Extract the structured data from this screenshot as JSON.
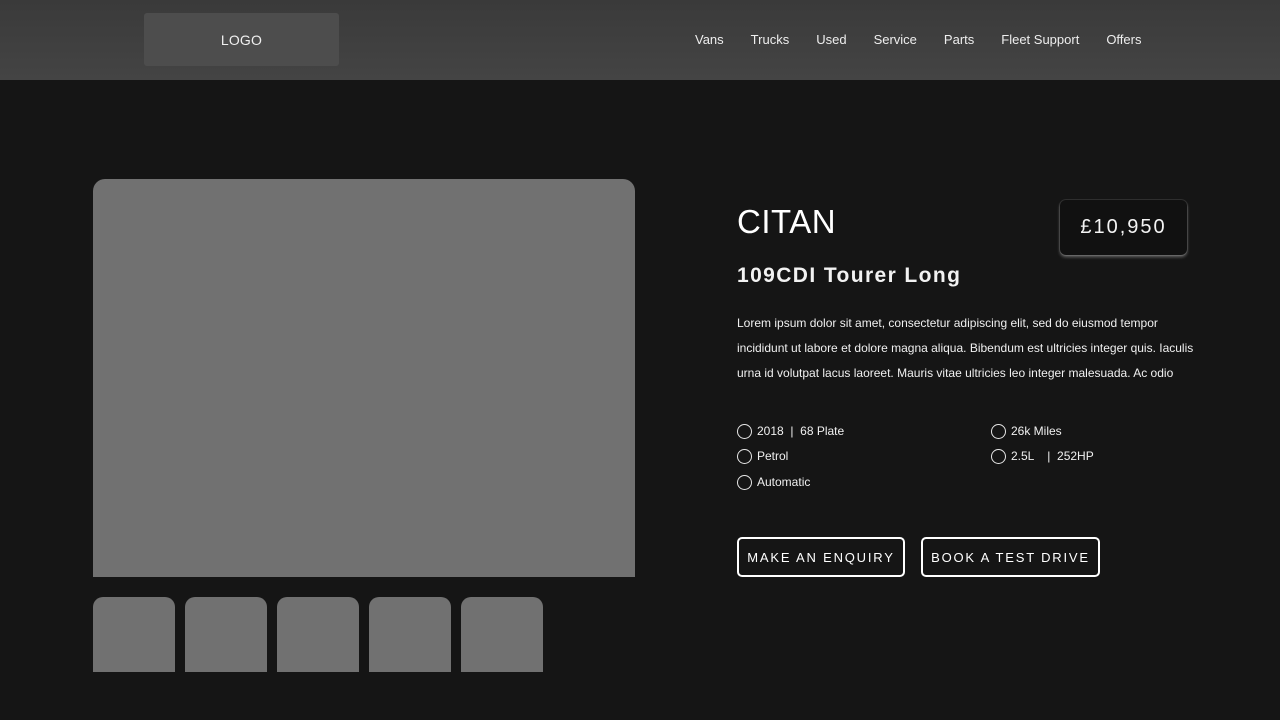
{
  "header": {
    "logo_text": "LOGO",
    "nav": [
      "Vans",
      "Trucks",
      "Used",
      "Service",
      "Parts",
      "Fleet Support",
      "Offers"
    ]
  },
  "vehicle": {
    "title": "CITAN",
    "subtitle": "109CDI Tourer Long",
    "price": "£10,950",
    "description": "Lorem ipsum dolor sit amet, consectetur adipiscing elit, sed do eiusmod tempor incididunt ut labore et dolore magna aliqua. Bibendum est ultricies integer quis. Iaculis urna id volutpat lacus laoreet. Mauris vitae ultricies leo integer malesuada. Ac odio",
    "specs": {
      "year_plate": "2018  |  68 Plate",
      "fuel": "Petrol",
      "transmission": "Automatic",
      "mileage": "26k Miles",
      "engine": "2.5L    |  252HP"
    }
  },
  "gallery": {
    "thumbnail_count": 5
  },
  "actions": {
    "enquiry_label": "MAKE AN ENQUIRY",
    "test_drive_label": "BOOK A TEST DRIVE"
  },
  "colors": {
    "background": "#151515",
    "header": "#3f3f3f",
    "placeholder": "#717171"
  }
}
